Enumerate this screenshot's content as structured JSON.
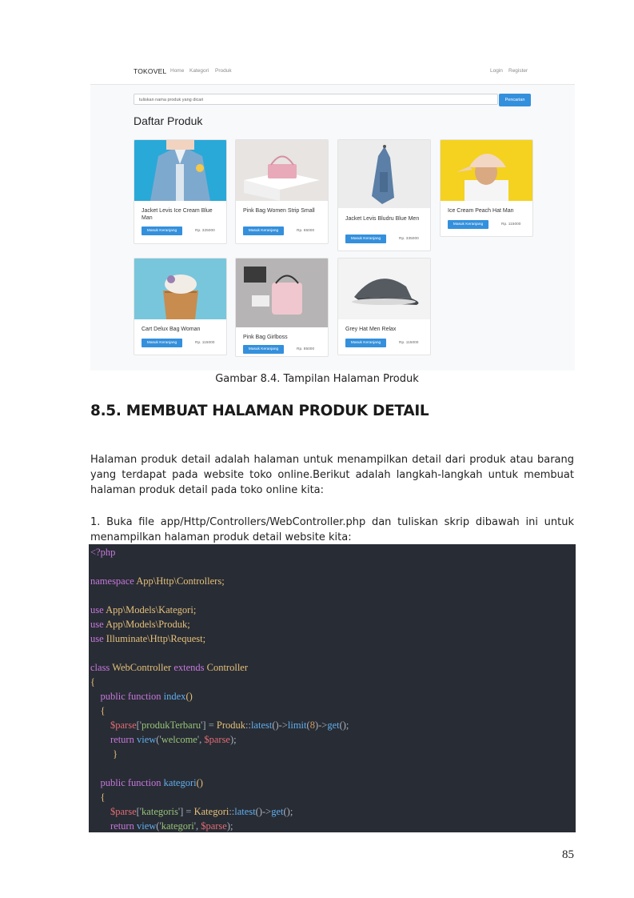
{
  "figure": {
    "navbar": {
      "brand": "TOKOVEL",
      "links": [
        "Home",
        "Kategori",
        "Produk"
      ],
      "right_links": [
        "Login",
        "Register"
      ]
    },
    "search": {
      "placeholder": "tuliskan nama produk yang dicari",
      "button": "Pencarian"
    },
    "title": "Daftar Produk",
    "products": [
      {
        "name": "Jacket Levis Ice Cream Blue Man",
        "button": "Masuk Keranjang",
        "price": "Rp. 325000"
      },
      {
        "name": "Pink Bag Women Strip Small",
        "button": "Masuk Keranjang",
        "price": "Rp. 65000"
      },
      {
        "name": "Jacket Levis Bludru Blue Men",
        "button": "Masuk Keranjang",
        "price": "Rp. 335000"
      },
      {
        "name": "Ice Cream Peach Hat Man",
        "button": "Masuk Keranjang",
        "price": "Rp. 115000"
      },
      {
        "name": "Cart Delux Bag Woman",
        "button": "Masuk Keranjang",
        "price": "Rp. 115000"
      },
      {
        "name": "Pink Bag Girlboss",
        "button": "Masuk Keranjang",
        "price": "Rp. 85000"
      },
      {
        "name": "Grey Hat Men Relax",
        "button": "Masuk Keranjang",
        "price": "Rp. 115000"
      }
    ]
  },
  "caption": "Gambar 8.4. Tampilan Halaman Produk",
  "heading": "8.5. MEMBUAT HALAMAN PRODUK DETAIL",
  "paragraph1": "Halaman produk detail adalah halaman untuk menampilkan detail dari produk atau barang yang terdapat pada website toko online.Berikut adalah langkah-langkah untuk membuat halaman produk detail pada toko online kita:",
  "paragraph2": "1. Buka file app/Http/Controllers/WebController.php dan tuliskan skrip dibawah ini untuk menampilkan halaman produk detail website kita:",
  "code_lines": [
    [
      {
        "t": "<?php",
        "c": "#c678dd"
      }
    ],
    [],
    [
      {
        "t": "namespace ",
        "c": "#c678dd"
      },
      {
        "t": "App\\Http\\Controllers;",
        "c": "#e5c07b"
      }
    ],
    [],
    [
      {
        "t": "use ",
        "c": "#c678dd"
      },
      {
        "t": "App\\Models\\Kategori;",
        "c": "#e5c07b"
      }
    ],
    [
      {
        "t": "use ",
        "c": "#c678dd"
      },
      {
        "t": "App\\Models\\Produk;",
        "c": "#e5c07b"
      }
    ],
    [
      {
        "t": "use ",
        "c": "#c678dd"
      },
      {
        "t": "Illuminate\\Http\\Request;",
        "c": "#e5c07b"
      }
    ],
    [],
    [
      {
        "t": "class ",
        "c": "#c678dd"
      },
      {
        "t": "WebController ",
        "c": "#e5c07b"
      },
      {
        "t": "extends ",
        "c": "#c678dd"
      },
      {
        "t": "Controller",
        "c": "#e5c07b"
      }
    ],
    [
      {
        "t": "{",
        "c": "#e5c07b"
      }
    ],
    [
      {
        "t": "    public function ",
        "c": "#c678dd"
      },
      {
        "t": "index",
        "c": "#61afef"
      },
      {
        "t": "()",
        "c": "#e5c07b"
      }
    ],
    [
      {
        "t": "    {",
        "c": "#e5c07b"
      }
    ],
    [
      {
        "t": "        $parse",
        "c": "#e06c75"
      },
      {
        "t": "['",
        "c": "#abb2bf"
      },
      {
        "t": "produkTerbaru",
        "c": "#98c379"
      },
      {
        "t": "'] = ",
        "c": "#abb2bf"
      },
      {
        "t": "Produk",
        "c": "#e5c07b"
      },
      {
        "t": "::",
        "c": "#abb2bf"
      },
      {
        "t": "latest",
        "c": "#61afef"
      },
      {
        "t": "()->",
        "c": "#abb2bf"
      },
      {
        "t": "limit",
        "c": "#61afef"
      },
      {
        "t": "(",
        "c": "#abb2bf"
      },
      {
        "t": "8",
        "c": "#d19a66"
      },
      {
        "t": ")->",
        "c": "#abb2bf"
      },
      {
        "t": "get",
        "c": "#61afef"
      },
      {
        "t": "();",
        "c": "#abb2bf"
      }
    ],
    [
      {
        "t": "        return ",
        "c": "#c678dd"
      },
      {
        "t": "view",
        "c": "#61afef"
      },
      {
        "t": "('",
        "c": "#abb2bf"
      },
      {
        "t": "welcome",
        "c": "#98c379"
      },
      {
        "t": "', ",
        "c": "#abb2bf"
      },
      {
        "t": "$parse",
        "c": "#e06c75"
      },
      {
        "t": ");",
        "c": "#abb2bf"
      }
    ],
    [
      {
        "t": "         }",
        "c": "#e5c07b"
      }
    ],
    [],
    [
      {
        "t": "    public function ",
        "c": "#c678dd"
      },
      {
        "t": "kategori",
        "c": "#61afef"
      },
      {
        "t": "()",
        "c": "#e5c07b"
      }
    ],
    [
      {
        "t": "    {",
        "c": "#e5c07b"
      }
    ],
    [
      {
        "t": "        $parse",
        "c": "#e06c75"
      },
      {
        "t": "['",
        "c": "#abb2bf"
      },
      {
        "t": "kategoris",
        "c": "#98c379"
      },
      {
        "t": "'] = ",
        "c": "#abb2bf"
      },
      {
        "t": "Kategori",
        "c": "#e5c07b"
      },
      {
        "t": "::",
        "c": "#abb2bf"
      },
      {
        "t": "latest",
        "c": "#61afef"
      },
      {
        "t": "()->",
        "c": "#abb2bf"
      },
      {
        "t": "get",
        "c": "#61afef"
      },
      {
        "t": "();",
        "c": "#abb2bf"
      }
    ],
    [
      {
        "t": "        return ",
        "c": "#c678dd"
      },
      {
        "t": "view",
        "c": "#61afef"
      },
      {
        "t": "('",
        "c": "#abb2bf"
      },
      {
        "t": "kategori",
        "c": "#98c379"
      },
      {
        "t": "', ",
        "c": "#abb2bf"
      },
      {
        "t": "$parse",
        "c": "#e06c75"
      },
      {
        "t": ");",
        "c": "#abb2bf"
      }
    ]
  ],
  "page_number": "85"
}
